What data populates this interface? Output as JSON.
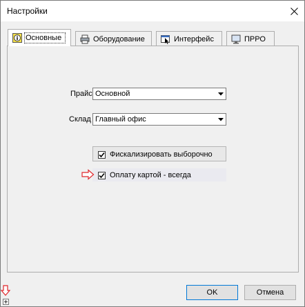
{
  "window": {
    "title": "Настройки"
  },
  "tabs": [
    {
      "label": "Основные",
      "icon": "info-icon",
      "active": true
    },
    {
      "label": "Оборудование",
      "icon": "printer-icon",
      "active": false
    },
    {
      "label": "Интерфейс",
      "icon": "cursor-window-icon",
      "active": false
    },
    {
      "label": "ПРРО",
      "icon": "monitor-icon",
      "active": false
    }
  ],
  "form": {
    "price_label": "Прайс",
    "price_value": "Основной",
    "warehouse_label": "Склад",
    "warehouse_value": "Главный офис",
    "fiscalize_label": "Фискализировать выборочно",
    "fiscalize_checked": true,
    "card_label": "Оплату картой - всегда",
    "card_checked": true
  },
  "buttons": {
    "ok": "OK",
    "cancel": "Отмена"
  },
  "colors": {
    "annotation_arrow": "#e0262b",
    "default_button_border": "#0078d7"
  }
}
